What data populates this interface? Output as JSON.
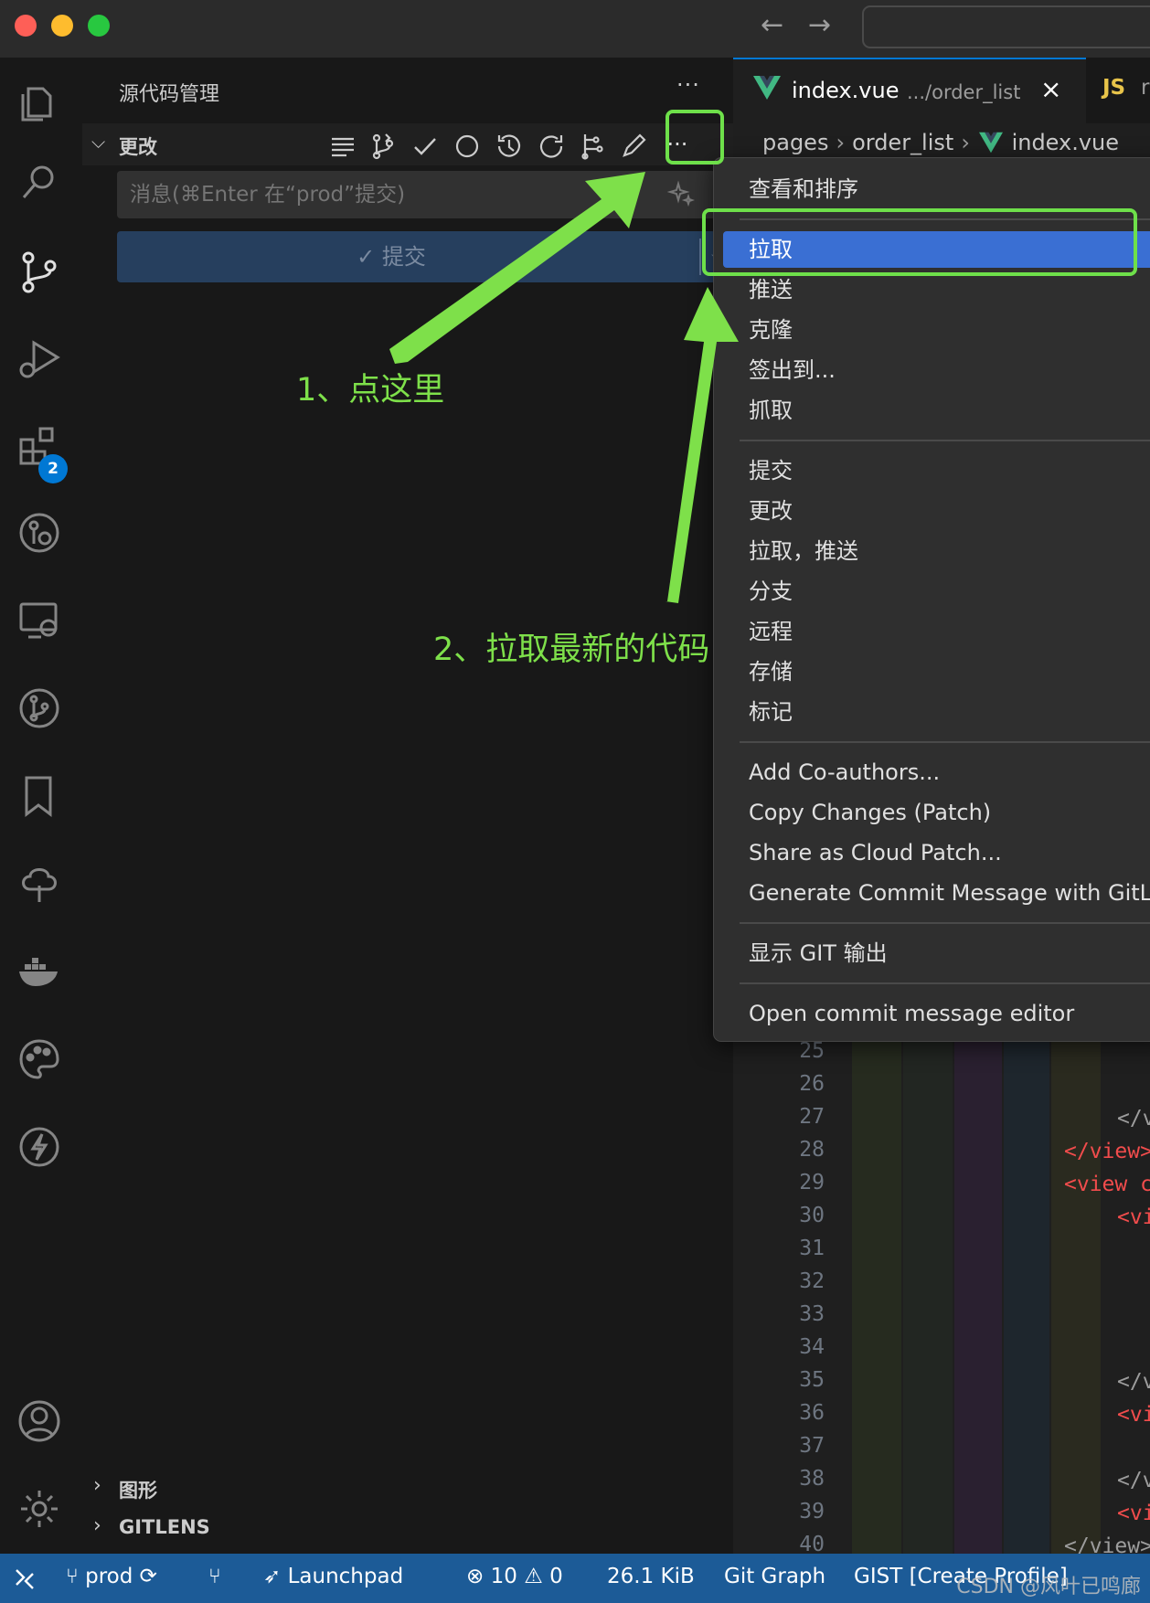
{
  "activity_badge": "2",
  "sidebar": {
    "title": "源代码管理",
    "more": "···",
    "changes_label": "更改",
    "commit_placeholder": "消息(⌘Enter 在“prod”提交)",
    "commit_button": "✓ 提交",
    "sections": [
      {
        "label": "图形"
      },
      {
        "label": "GITLENS"
      }
    ]
  },
  "editor": {
    "active_tab": {
      "name": "index.vue",
      "path": ".../order_list"
    },
    "next_tab": {
      "icon_text": "JS",
      "name": "re"
    },
    "breadcrumb": [
      "pages",
      "order_list",
      "index.vue"
    ],
    "line_numbers": [
      "25",
      "26",
      "27",
      "28",
      "29",
      "30",
      "31",
      "32",
      "33",
      "34",
      "35",
      "36",
      "37",
      "38",
      "39",
      "40"
    ],
    "code_fragments": [
      {
        "text": "</v",
        "line": "27"
      },
      {
        "text": "</view>",
        "line": "28"
      },
      {
        "text": "<view c",
        "line": "29"
      },
      {
        "text": "<vi",
        "line": "30"
      },
      {
        "text": "</v",
        "line": "35"
      },
      {
        "text": "<vi",
        "line": "36"
      },
      {
        "text": "</v",
        "line": "38"
      },
      {
        "text": "<vi",
        "line": "39"
      },
      {
        "text": "</view>",
        "line": "40"
      }
    ]
  },
  "context_menu": {
    "items": [
      "查看和排序",
      "拉取",
      "推送",
      "克隆",
      "签出到...",
      "抓取",
      "提交",
      "更改",
      "拉取，推送",
      "分支",
      "远程",
      "存储",
      "标记",
      "Add Co-authors...",
      "Copy Changes (Patch)",
      "Share as Cloud Patch...",
      "Generate Commit Message with GitLens",
      "显示 GIT 输出",
      "Open commit message editor"
    ],
    "selected": "拉取"
  },
  "annotations": {
    "step1": "1、点这里",
    "step2": "2、拉取最新的代码"
  },
  "statusbar": {
    "branch": "prod",
    "launchpad": "Launchpad",
    "errors": "10",
    "warnings": "0",
    "size": "26.1 KiB",
    "git_graph": "Git Graph",
    "gist": "GIST [Create Profile]"
  },
  "watermark": "CSDN @风叶已鸣廊",
  "colors": {
    "accent": "#0078d4",
    "annotation_green": "#7ee04a",
    "menu_selected": "#3a6fd3",
    "statusbar": "#1c5b97"
  }
}
